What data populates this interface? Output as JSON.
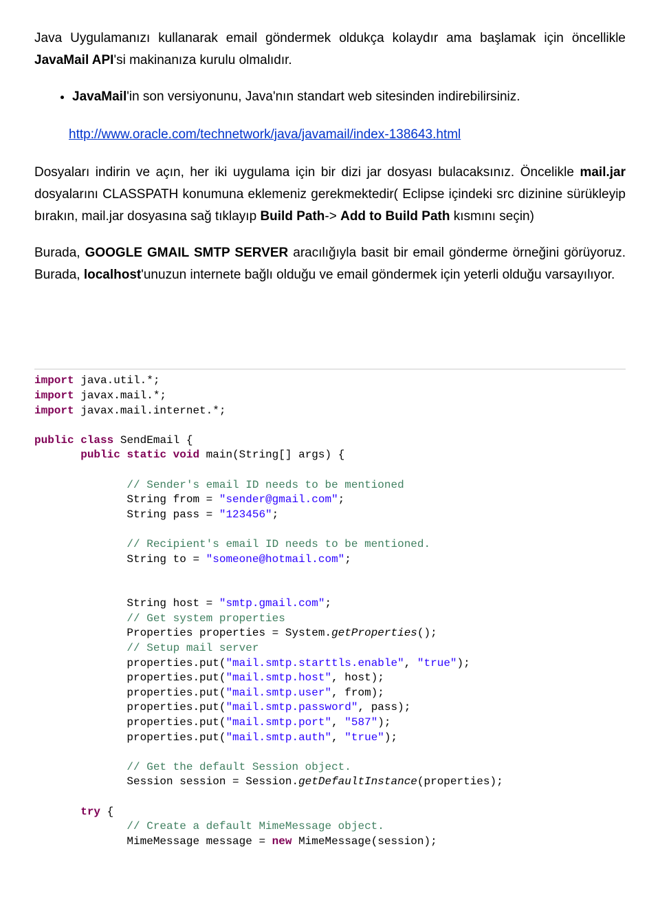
{
  "prose": {
    "p1_a": "Java Uygulamanızı kullanarak email göndermek oldukça kolaydır ama başlamak için öncellikle ",
    "p1_b": "JavaMail API",
    "p1_c": "'si makinanıza kurulu olmalıdır.",
    "bullet_a": "JavaMail",
    "bullet_b": "'in son versiyonunu, Java'nın standart web sitesinden indirebilirsiniz.",
    "link": "http://www.oracle.com/technetwork/java/javamail/index-138643.html",
    "p2_a": "Dosyaları indirin ve açın, her iki uygulama için bir dizi jar dosyası bulacaksınız. Öncelikle ",
    "p2_b": "mail.jar",
    "p2_c": " dosyalarını CLASSPATH konumuna eklemeniz gerekmektedir( Eclipse içindeki src dizinine sürükleyip bırakın, mail.jar dosyasına sağ tıklayıp ",
    "p2_d": "Build Path",
    "p2_e": "-> ",
    "p2_f": "Add to Build Path",
    "p2_g": " kısmını seçin)",
    "p3_a": "Burada, ",
    "p3_b": "GOOGLE GMAIL SMTP SERVER",
    "p3_c": " aracılığıyla basit bir email gönderme örneğini görüyoruz. Burada, ",
    "p3_d": "localhost",
    "p3_e": "'unuzun internete bağlı olduğu ve email göndermek için yeterli olduğu varsayılıyor."
  },
  "code": {
    "import": "import",
    "l1": " java.util.*;",
    "l2": " javax.mail.*;",
    "l3": " javax.mail.internet.*;",
    "public": "public",
    "class": "class",
    "cls_name": " SendEmail {",
    "static": "static",
    "void": "void",
    "main_sig": " main(String[] args) {",
    "c_sender": "// Sender's email ID needs to be mentioned",
    "from_a": "String from = ",
    "from_b": "\"sender@gmail.com\"",
    "semi": ";",
    "pass_a": "String pass = ",
    "pass_b": "\"123456\"",
    "c_recip": "// Recipient's email ID needs to be mentioned.",
    "to_a": "String to = ",
    "to_b": "\"someone@hotmail.com\"",
    "host_a": "String host = ",
    "host_b": "\"smtp.gmail.com\"",
    "c_sysprop": "// Get system properties",
    "prop_a": "Properties properties = System.",
    "prop_b": "getProperties",
    "prop_c": "();",
    "c_setup": "// Setup mail server",
    "put": "properties.put(",
    "k_starttls": "\"mail.smtp.starttls.enable\"",
    "comma": ", ",
    "v_true": "\"true\"",
    "close": ");",
    "k_host": "\"mail.smtp.host\"",
    "v_host": "host);",
    "k_user": "\"mail.smtp.user\"",
    "v_from": "from);",
    "k_pass": "\"mail.smtp.password\"",
    "v_pass": "pass);",
    "k_port": "\"mail.smtp.port\"",
    "v_port": "\"587\"",
    "k_auth": "\"mail.smtp.auth\"",
    "c_session": "// Get the default Session object.",
    "sess_a": "Session session = Session.",
    "sess_b": "getDefaultInstance",
    "sess_c": "(properties);",
    "try": "try",
    "try_brace": " {",
    "c_mime": "// Create a default MimeMessage object.",
    "mime_a": "MimeMessage message = ",
    "new": "new",
    "mime_b": " MimeMessage(session);"
  }
}
